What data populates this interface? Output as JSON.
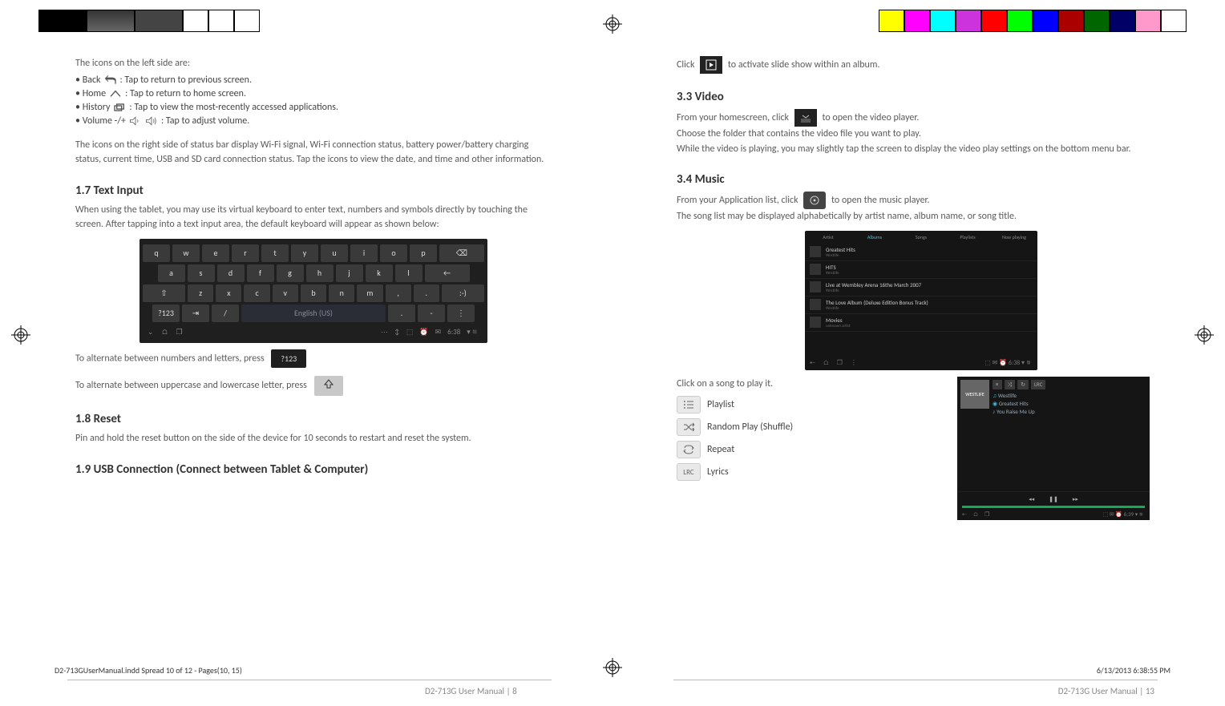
{
  "left": {
    "intro": "The icons on the left side are:",
    "bulBack1": "• Back",
    "bulBack2": ": Tap to return to previous screen.",
    "bulHome1": "• Home",
    "bulHome2": ": Tap to return to home screen.",
    "bulHist1": "• History",
    "bulHist2": ": Tap to view the most-recently accessed applications.",
    "bulVol1": "• Volume -/+",
    "bulVol2": ": Tap to adjust volume.",
    "rightIcons": "The icons on the right side of status bar display Wi-Fi signal, Wi-Fi connection status, battery power/battery charging status, current time, USB and SD card connection status. Tap the icons to view the date, and time and other information.",
    "h17": "1.7 Text Input",
    "p17": "When using the tablet, you may use its virtual keyboard to enter text, numbers and symbols directly by touching the screen. After tapping into a text input area, the default keyboard will appear as shown below:",
    "altNumLetter": "To alternate between numbers and letters, press",
    "altCase": "To alternate between uppercase and lowercase letter, press",
    "keyNum": "?123",
    "h18": "1.8 Reset",
    "p18": "Pin and hold the reset button on the side of the device for 10 seconds to restart and reset the system.",
    "h19": "1.9 USB Connection (Connect between Tablet & Computer)",
    "footer": "D2-713G User Manual | 8"
  },
  "right": {
    "slide1": "Click",
    "slide2": "to activate slide show within an album.",
    "h33": "3.3 Video",
    "vid1": "From your homescreen, click",
    "vid2": "to open the video player.",
    "vidp1": "Choose the folder that contains the video file you want to play.",
    "vidp2": "While the video is playing, you may slightly tap the screen to display the video play settings on the bottom menu bar.",
    "h34": "3.4 Music",
    "mus1": "From your Application list, click",
    "mus2": "to open the music player.",
    "musp": "The song list may be displayed alphabetically by artist name, album name, or song title.",
    "tabs": {
      "a": "Artist",
      "b": "Albums",
      "c": "Songs",
      "d": "Playlists",
      "e": "Now playing"
    },
    "albums": {
      "a1": "Greatest Hits",
      "a1s": "Westlife",
      "a2": "HITS",
      "a2s": "Westlife",
      "a3": "Live at Wembley Arena 16the March 2007",
      "a3s": "Westlife",
      "a4": "The Love Album (Deluxe Edition Bonus Track)",
      "a4s": "Westlife",
      "a5": "Movies",
      "a5s": "unknown artist"
    },
    "clickSong": "Click on a song to play it.",
    "playlist": "Playlist",
    "shuffle": "Random Play (Shuffle)",
    "repeat": "Repeat",
    "lyrics": "Lyrics",
    "lrcChip": "LRC",
    "player": {
      "art": "WESTLIFE",
      "l1": "Westlife",
      "l2": "Greatest Hits",
      "l3": "You Raise Me Up"
    },
    "footer": "D2-713G User Manual | 13"
  },
  "spread": {
    "file": "D2-713GUserManual.indd   Spread 10 of 12 - Pages(10, 15)",
    "time": "6/13/2013   6:38:55 PM"
  },
  "kb": {
    "r1": [
      "q",
      "w",
      "e",
      "r",
      "t",
      "y",
      "u",
      "i",
      "o",
      "p",
      "⌫"
    ],
    "r2": [
      "a",
      "s",
      "d",
      "f",
      "g",
      "h",
      "j",
      "k",
      "l",
      "←"
    ],
    "r3": [
      "⇧",
      "z",
      "x",
      "c",
      "v",
      "b",
      "n",
      "m",
      ",",
      ".",
      ":-)"
    ],
    "r4": [
      "?123",
      "⇥",
      "/",
      "English (US)",
      ".",
      "-",
      "⋮"
    ],
    "time": "6:38"
  }
}
